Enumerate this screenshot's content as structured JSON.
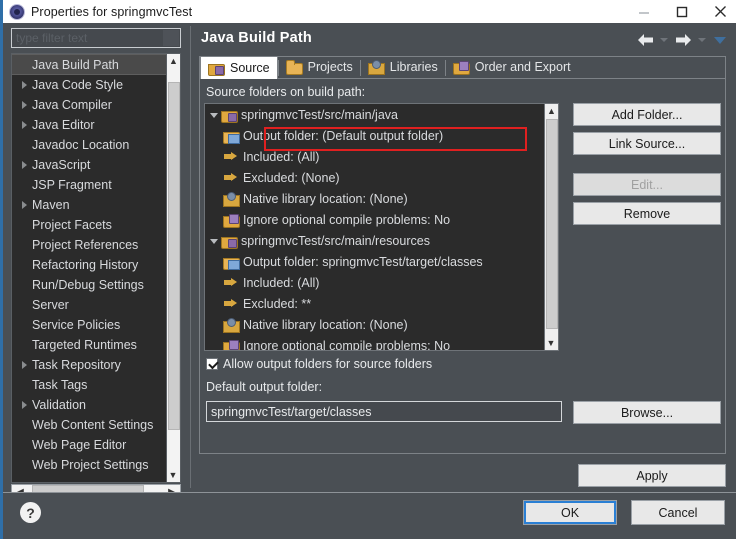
{
  "window": {
    "title": "Properties for springmvcTest",
    "icon": "eclipse-icon",
    "minimize": "minimize-icon",
    "maximize": "maximize-icon",
    "close": "close-icon"
  },
  "sidebar": {
    "filter": {
      "placeholder": "type filter text",
      "value": ""
    },
    "items": [
      {
        "label": "Java Build Path",
        "expandable": false,
        "selected": true
      },
      {
        "label": "Java Code Style",
        "expandable": true,
        "selected": false
      },
      {
        "label": "Java Compiler",
        "expandable": true,
        "selected": false
      },
      {
        "label": "Java Editor",
        "expandable": true,
        "selected": false
      },
      {
        "label": "Javadoc Location",
        "expandable": false,
        "selected": false
      },
      {
        "label": "JavaScript",
        "expandable": true,
        "selected": false
      },
      {
        "label": "JSP Fragment",
        "expandable": false,
        "selected": false
      },
      {
        "label": "Maven",
        "expandable": true,
        "selected": false
      },
      {
        "label": "Project Facets",
        "expandable": false,
        "selected": false
      },
      {
        "label": "Project References",
        "expandable": false,
        "selected": false
      },
      {
        "label": "Refactoring History",
        "expandable": false,
        "selected": false
      },
      {
        "label": "Run/Debug Settings",
        "expandable": false,
        "selected": false
      },
      {
        "label": "Server",
        "expandable": false,
        "selected": false
      },
      {
        "label": "Service Policies",
        "expandable": false,
        "selected": false
      },
      {
        "label": "Targeted Runtimes",
        "expandable": false,
        "selected": false
      },
      {
        "label": "Task Repository",
        "expandable": true,
        "selected": false
      },
      {
        "label": "Task Tags",
        "expandable": false,
        "selected": false
      },
      {
        "label": "Validation",
        "expandable": true,
        "selected": false
      },
      {
        "label": "Web Content Settings",
        "expandable": false,
        "selected": false
      },
      {
        "label": "Web Page Editor",
        "expandable": false,
        "selected": false
      },
      {
        "label": "Web Project Settings",
        "expandable": false,
        "selected": false
      }
    ]
  },
  "page": {
    "title": "Java Build Path",
    "nav": {
      "back": "back-arrow-icon",
      "back_menu": "chevron-down-icon",
      "forward": "forward-arrow-icon",
      "forward_menu": "chevron-down-icon",
      "menu": "view-menu-icon"
    },
    "tabs": [
      {
        "label": "Source",
        "icon": "source-folder-icon",
        "active": true
      },
      {
        "label": "Projects",
        "icon": "projects-folder-icon",
        "active": false
      },
      {
        "label": "Libraries",
        "icon": "libraries-icon",
        "active": false
      },
      {
        "label": "Order and Export",
        "icon": "order-export-icon",
        "active": false
      }
    ],
    "source_folders_label": "Source folders on build path:",
    "tree": [
      {
        "label": "springmvcTest/src/main/java",
        "icon": "source-folder-icon",
        "level": 0,
        "expanded": true,
        "highlighted": false
      },
      {
        "label": "Output folder: (Default output folder)",
        "icon": "output-folder-icon",
        "level": 1,
        "expanded": false,
        "highlighted": true
      },
      {
        "label": "Included: (All)",
        "icon": "included-icon",
        "level": 1,
        "expanded": false,
        "highlighted": false
      },
      {
        "label": "Excluded: (None)",
        "icon": "excluded-icon",
        "level": 1,
        "expanded": false,
        "highlighted": false
      },
      {
        "label": "Native library location: (None)",
        "icon": "native-library-icon",
        "level": 1,
        "expanded": false,
        "highlighted": false
      },
      {
        "label": "Ignore optional compile problems: No",
        "icon": "ignore-problems-icon",
        "level": 1,
        "expanded": false,
        "highlighted": false
      },
      {
        "label": "springmvcTest/src/main/resources",
        "icon": "source-folder-icon",
        "level": 0,
        "expanded": true,
        "highlighted": false
      },
      {
        "label": "Output folder: springmvcTest/target/classes",
        "icon": "output-folder-icon",
        "level": 1,
        "expanded": false,
        "highlighted": false
      },
      {
        "label": "Included: (All)",
        "icon": "included-icon",
        "level": 1,
        "expanded": false,
        "highlighted": false
      },
      {
        "label": "Excluded: **",
        "icon": "excluded-icon",
        "level": 1,
        "expanded": false,
        "highlighted": false
      },
      {
        "label": "Native library location: (None)",
        "icon": "native-library-icon",
        "level": 1,
        "expanded": false,
        "highlighted": false
      },
      {
        "label": "Ignore optional compile problems: No",
        "icon": "ignore-problems-icon",
        "level": 1,
        "expanded": false,
        "highlighted": false
      }
    ],
    "buttons": {
      "add_folder": "Add Folder...",
      "link_source": "Link Source...",
      "edit": "Edit...",
      "remove": "Remove",
      "browse": "Browse...",
      "apply": "Apply"
    },
    "allow_output_folders": {
      "label": "Allow output folders for source folders",
      "checked": true
    },
    "default_output_folder": {
      "label": "Default output folder:",
      "value": "springmvcTest/target/classes"
    }
  },
  "footer": {
    "help": "?",
    "ok": "OK",
    "cancel": "Cancel"
  },
  "colors": {
    "highlight_rect": "#e02020",
    "focus_outline": "#2a7fd4",
    "window_bg": "#4a4f54",
    "tree_bg": "#2b2b2b"
  }
}
